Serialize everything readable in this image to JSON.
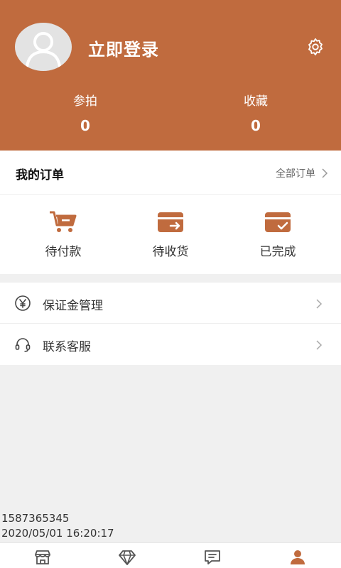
{
  "header": {
    "login_label": "立即登录",
    "stats": [
      {
        "label": "参拍",
        "value": "0"
      },
      {
        "label": "收藏",
        "value": "0"
      }
    ]
  },
  "orders": {
    "title": "我的订单",
    "all_label": "全部订单",
    "items": [
      {
        "label": "待付款",
        "icon": "cart-icon"
      },
      {
        "label": "待收货",
        "icon": "card-transfer-icon"
      },
      {
        "label": "已完成",
        "icon": "card-check-icon"
      }
    ]
  },
  "menu": [
    {
      "label": "保证金管理",
      "icon": "yen-circle-icon"
    },
    {
      "label": "联系客服",
      "icon": "headset-icon"
    }
  ],
  "footer": {
    "line1": "1587365345",
    "line2": "2020/05/01 16:20:17"
  },
  "tabbar": {
    "tabs": [
      "shop-icon",
      "diamond-icon",
      "message-icon",
      "user-icon"
    ],
    "active_index": 3
  },
  "colors": {
    "accent": "#c06b3e",
    "background": "#f0f0f0",
    "tab_inactive": "#555555"
  }
}
